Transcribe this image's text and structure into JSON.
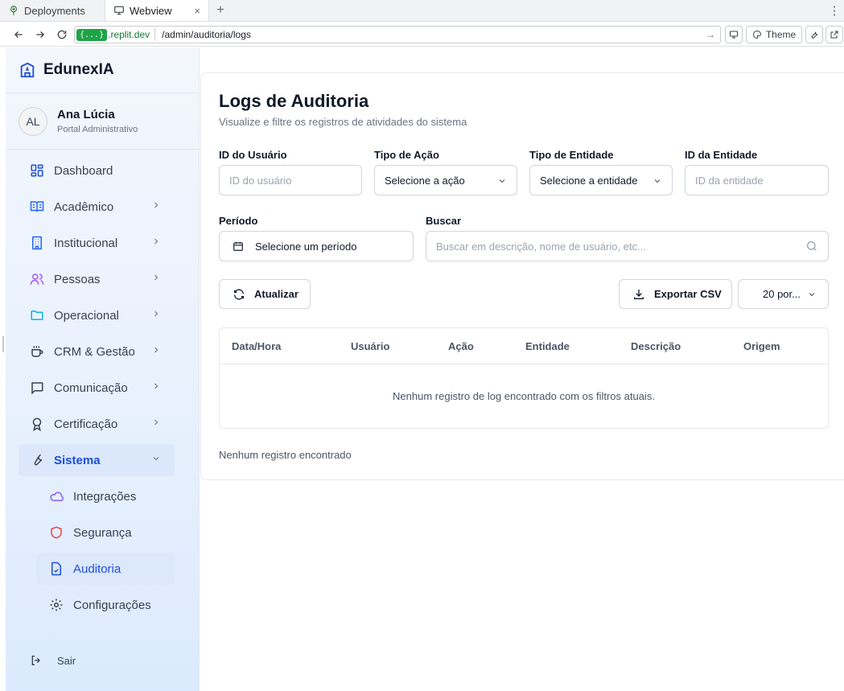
{
  "browser": {
    "tabs": [
      {
        "label": "Deployments",
        "icon": "deployments-icon"
      },
      {
        "label": "Webview",
        "icon": "monitor-icon",
        "close": "×"
      }
    ],
    "new_tab": "+",
    "menu": "⋮",
    "url": {
      "badge": "{...}",
      "host": ".replit.dev",
      "path": "/admin/auditoria/logs",
      "go": "→"
    },
    "theme_label": "Theme"
  },
  "sidebar": {
    "brand": "EdunexIA",
    "user": {
      "initials": "AL",
      "name": "Ana Lúcia",
      "role": "Portal Administrativo"
    },
    "items": [
      {
        "label": "Dashboard",
        "icon": "dashboard-icon"
      },
      {
        "label": "Acadêmico",
        "icon": "book-icon"
      },
      {
        "label": "Institucional",
        "icon": "building-icon"
      },
      {
        "label": "Pessoas",
        "icon": "users-icon"
      },
      {
        "label": "Operacional",
        "icon": "folder-icon"
      },
      {
        "label": "CRM & Gestão",
        "icon": "coffee-icon"
      },
      {
        "label": "Comunicação",
        "icon": "message-icon"
      },
      {
        "label": "Certificação",
        "icon": "award-icon"
      },
      {
        "label": "Sistema",
        "icon": "wrench-icon"
      }
    ],
    "subitems": [
      {
        "label": "Integrações",
        "icon": "cloud-icon"
      },
      {
        "label": "Segurança",
        "icon": "shield-icon"
      },
      {
        "label": "Auditoria",
        "icon": "file-check-icon"
      },
      {
        "label": "Configurações",
        "icon": "settings-icon"
      }
    ],
    "logout": "Sair"
  },
  "page": {
    "title": "Logs de Auditoria",
    "subtitle": "Visualize e filtre os registros de atividades do sistema",
    "filters": {
      "user_id": {
        "label": "ID do Usuário",
        "placeholder": "ID do usuário"
      },
      "action_type": {
        "label": "Tipo de Ação",
        "value": "Selecione a ação"
      },
      "entity_type": {
        "label": "Tipo de Entidade",
        "value": "Selecione a entidade"
      },
      "entity_id": {
        "label": "ID da Entidade",
        "placeholder": "ID da entidade"
      },
      "period": {
        "label": "Período",
        "value": "Selecione um período"
      },
      "search": {
        "label": "Buscar",
        "placeholder": "Buscar em descrição, nome de usuário, etc..."
      }
    },
    "actions": {
      "refresh": "Atualizar",
      "export": "Exportar CSV",
      "page_size": "20 por..."
    },
    "table": {
      "columns": [
        "Data/Hora",
        "Usuário",
        "Ação",
        "Entidade",
        "Descrição",
        "Origem"
      ],
      "empty_message": "Nenhum registro de log encontrado com os filtros atuais."
    },
    "footer_count": "Nenhum registro encontrado"
  },
  "colors": {
    "accent": "#1d4ed8",
    "active_bg": "#dbe7fb",
    "url_badge": "#1ea446",
    "users_icon": "#a855f7",
    "folder_icon": "#06b6d4",
    "cloud_icon": "#8b5cf6",
    "shield_icon": "#ef4444"
  }
}
